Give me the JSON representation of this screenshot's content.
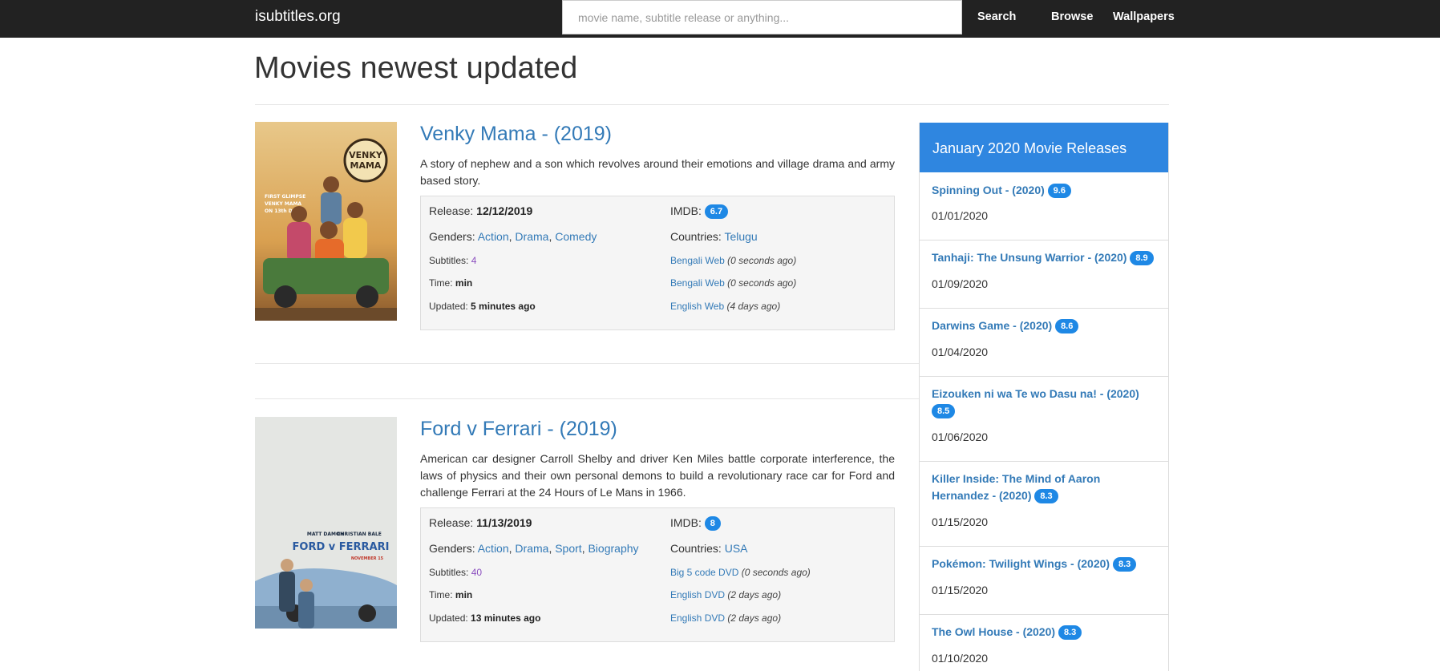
{
  "header": {
    "brand": "isubtitles.org",
    "search_placeholder": "movie name, subtitle release or anything...",
    "search_button": "Search",
    "nav": [
      "Browse",
      "Wallpapers"
    ]
  },
  "page_title": "Movies newest updated",
  "movies": [
    {
      "title": "Venky Mama  - (2019)",
      "description": "A story of nephew and a son which revolves around their emotions and village drama and army based story.",
      "release_label": "Release:",
      "release": "12/12/2019",
      "imdb_label": "IMDB:",
      "imdb": "6.7",
      "genres_label": "Genders:",
      "genres": [
        "Action",
        "Drama",
        "Comedy"
      ],
      "countries_label": "Countries:",
      "countries": [
        "Telugu"
      ],
      "subtitles_label": "Subtitles:",
      "subtitles": "4",
      "time_label": "Time:",
      "time": "min",
      "updated_label": "Updated:",
      "updated": "5 minutes ago",
      "releases": [
        {
          "name": "Bengali Web",
          "ago": "(0 seconds ago)"
        },
        {
          "name": "Bengali Web",
          "ago": "(0 seconds ago)"
        },
        {
          "name": "English Web",
          "ago": "(4 days ago)"
        }
      ]
    },
    {
      "title": "Ford v Ferrari  - (2019)",
      "description": "American car designer Carroll Shelby and driver Ken Miles battle corporate interference, the laws of physics and their own personal demons to build a revolutionary race car for Ford and challenge Ferrari at the 24 Hours of Le Mans in 1966.",
      "release_label": "Release:",
      "release": "11/13/2019",
      "imdb_label": "IMDB:",
      "imdb": "8",
      "genres_label": "Genders:",
      "genres": [
        "Action",
        "Drama",
        "Sport",
        "Biography"
      ],
      "countries_label": "Countries:",
      "countries": [
        "USA"
      ],
      "subtitles_label": "Subtitles:",
      "subtitles": "40",
      "time_label": "Time:",
      "time": "min",
      "updated_label": "Updated:",
      "updated": "13 minutes ago",
      "releases": [
        {
          "name": "Big 5 code DVD",
          "ago": "(0 seconds ago)"
        },
        {
          "name": "English DVD",
          "ago": "(2 days ago)"
        },
        {
          "name": "English DVD",
          "ago": "(2 days ago)"
        }
      ]
    }
  ],
  "sidebar": {
    "title": "January 2020 Movie Releases",
    "items": [
      {
        "title": "Spinning Out  - (2020)",
        "rating": "9.6",
        "date": "01/01/2020"
      },
      {
        "title": "Tanhaji: The Unsung Warrior  - (2020)",
        "rating": "8.9",
        "date": "01/09/2020"
      },
      {
        "title": "Darwins Game  - (2020)",
        "rating": "8.6",
        "date": "01/04/2020"
      },
      {
        "title": "Eizouken ni wa Te wo Dasu na!  - (2020)",
        "rating": "8.5",
        "date": "01/06/2020"
      },
      {
        "title": "Killer Inside: The Mind of Aaron Hernandez  - (2020)",
        "rating": "8.3",
        "date": "01/15/2020"
      },
      {
        "title": "Pokémon: Twilight Wings  - (2020)",
        "rating": "8.3",
        "date": "01/15/2020"
      },
      {
        "title": "The Owl House  - (2020)",
        "rating": "8.3",
        "date": "01/10/2020"
      }
    ]
  },
  "posters": [
    {
      "lines": [
        "FIRST GLIMPSE",
        "VENKY MAMA",
        "ON 13th DEC",
        "VENKY",
        "MAMA"
      ]
    },
    {
      "lines": [
        "MATT DAMON",
        "CHRISTIAN BALE",
        "FORD v FERRARI",
        "NOVEMBER 15"
      ]
    }
  ],
  "colors": {
    "navbar": "#222222",
    "link": "#337ab7",
    "badge": "#1e88e5",
    "sidebar_header": "#2f86e0",
    "details_bg": "#f5f5f5"
  }
}
